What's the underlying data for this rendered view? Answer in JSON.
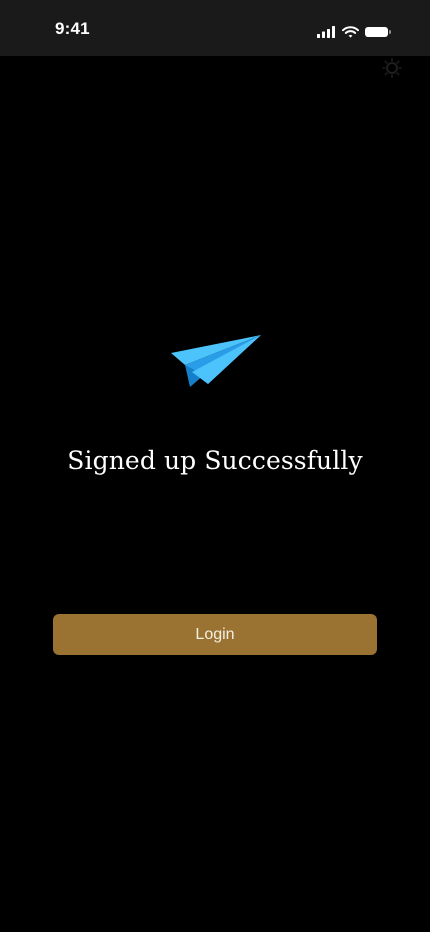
{
  "status_bar": {
    "time": "9:41"
  },
  "icons": {
    "cellular": "cellular-signal-icon",
    "wifi": "wifi-icon",
    "battery": "battery-icon",
    "theme": "sun-icon",
    "hero": "paper-plane-icon"
  },
  "main": {
    "title": "Signed up Successfully",
    "login_label": "Login"
  },
  "colors": {
    "background": "#000000",
    "status_bar": "#1a1a1a",
    "button": "#9a7332",
    "plane_light": "#4cc3fb",
    "plane_dark": "#1c8dd6"
  }
}
